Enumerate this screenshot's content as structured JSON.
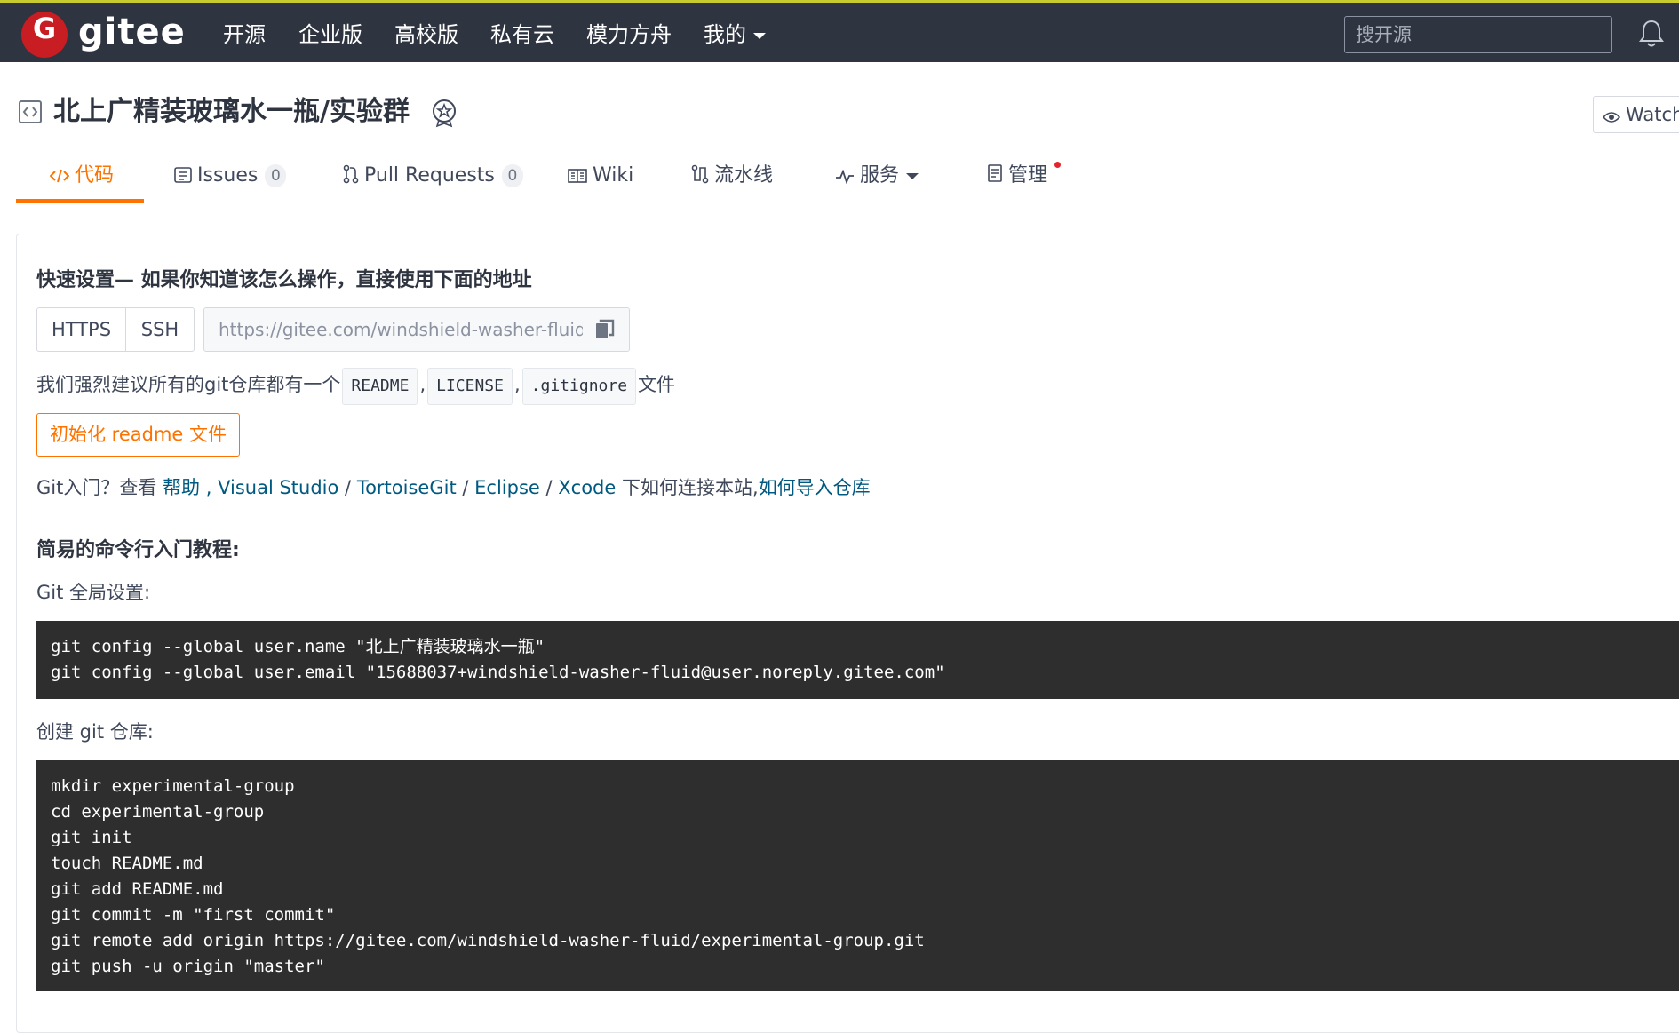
{
  "topbar": {
    "logo_glyph": "G",
    "logo_text": "gitee",
    "nav_items": [
      "开源",
      "企业版",
      "高校版",
      "私有云",
      "模力方舟",
      "我的"
    ],
    "search_placeholder": "搜开源",
    "brand_color": "#c71d23",
    "icons": [
      "bell-icon",
      "chevron-down-icon"
    ]
  },
  "repo": {
    "title": "北上广精装玻璃水一瓶/实验群",
    "watch_label": "Watch",
    "icons": [
      "repository-icon",
      "badge-icon",
      "eye-icon"
    ]
  },
  "tabs": [
    {
      "label": "代码",
      "icon": "code-icon",
      "active": true
    },
    {
      "label": "Issues",
      "count": "0",
      "icon": "issues-icon"
    },
    {
      "label": "Pull Requests",
      "count": "0",
      "icon": "pull-request-icon"
    },
    {
      "label": "Wiki",
      "icon": "book-icon"
    },
    {
      "label": "流水线",
      "icon": "pipeline-icon"
    },
    {
      "label": "服务",
      "icon": "pulse-icon",
      "has_dropdown": true
    },
    {
      "label": "管理",
      "icon": "manage-icon",
      "has_dot": true
    }
  ],
  "accent_color": "#fe7300",
  "quick_setup": {
    "heading": "快速设置— 如果你知道该怎么操作，直接使用下面的地址",
    "protocols": [
      "HTTPS",
      "SSH"
    ],
    "url": "https://gitee.com/windshield-washer-fluid/experimental-group.git",
    "recommend_prefix": "我们强烈建议所有的git仓库都有一个",
    "recommend_files": [
      "README",
      "LICENSE",
      ".gitignore"
    ],
    "recommend_sep": ",",
    "recommend_suffix": "文件",
    "init_button": "初始化 readme 文件",
    "guide": {
      "prefix": "Git入门？查看",
      "help_link": "帮助",
      "sep1": ",",
      "tools": [
        "Visual Studio",
        "TortoiseGit",
        "Eclipse",
        "Xcode"
      ],
      "slash": "/",
      "middle": "下如何连接本站,",
      "import_link": "如何导入仓库"
    }
  },
  "tutorial": {
    "heading": "简易的命令行入门教程:",
    "global_label": "Git 全局设置:",
    "global_commands": [
      "git config --global user.name \"北上广精装玻璃水一瓶\"",
      "git config --global user.email \"15688037+windshield-washer-fluid@user.noreply.gitee.com\""
    ],
    "create_label": "创建 git 仓库:",
    "create_commands": [
      "mkdir experimental-group",
      "cd experimental-group",
      "git init",
      "touch README.md",
      "git add README.md",
      "git commit -m \"first commit\"",
      "git remote add origin https://gitee.com/windshield-washer-fluid/experimental-group.git",
      "git push -u origin \"master\""
    ]
  }
}
